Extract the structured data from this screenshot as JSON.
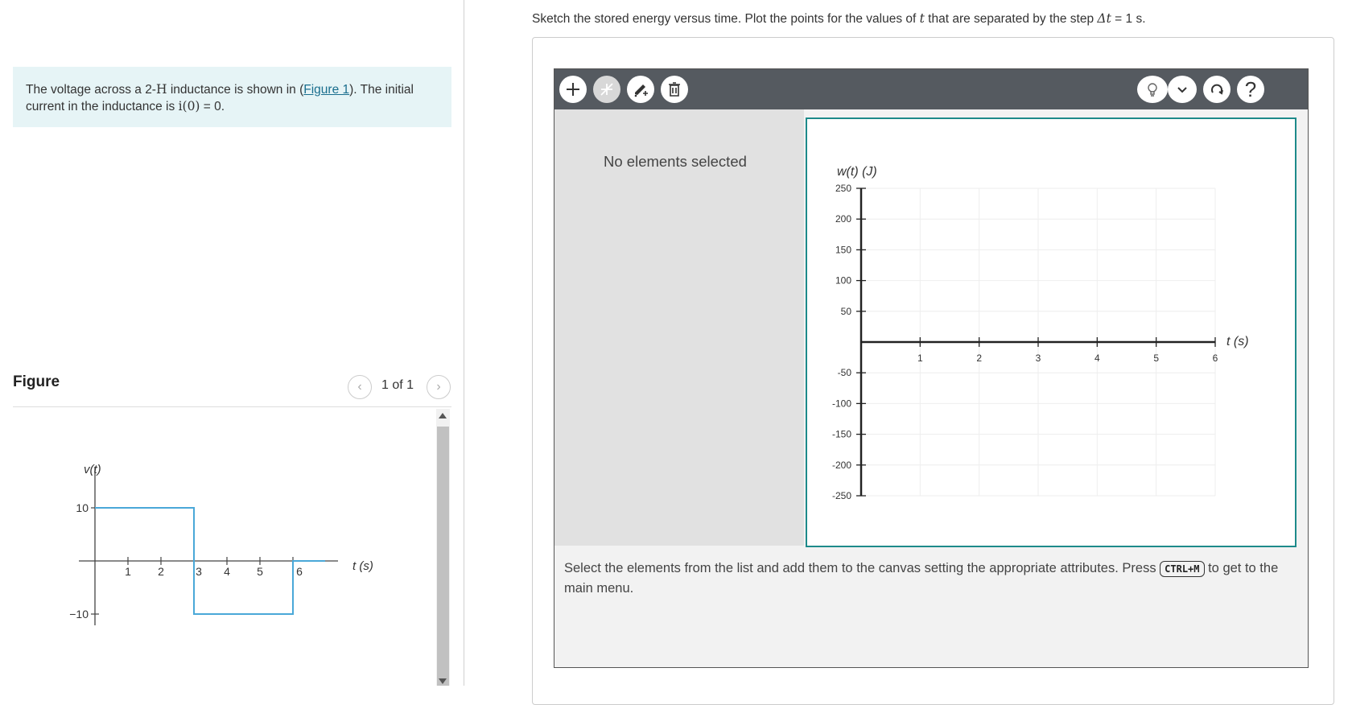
{
  "problem": {
    "text_before": "The voltage across a 2-",
    "unit_H": "H",
    "text_mid": " inductance is shown in (",
    "figure_link": "Figure 1",
    "text_after": "). The initial current in the inductance is ",
    "initial_condition": "i(0)",
    "text_end": " = 0."
  },
  "figure": {
    "title": "Figure",
    "pager": "1 of 1",
    "ylabel": "v(t)",
    "xlabel": "t (s)",
    "y_ticks": [
      "10",
      "−10"
    ],
    "x_ticks": [
      "1",
      "2",
      "3",
      "4",
      "5",
      "6"
    ],
    "waveform": [
      {
        "t0": 0,
        "t1": 3,
        "v": 10
      },
      {
        "t0": 3,
        "t1": 6,
        "v": -10
      }
    ],
    "trace_color": "#4aa8d8"
  },
  "instruction": {
    "text_before": "Sketch the stored energy versus time. Plot the points for the values of ",
    "var_t": "t",
    "text_mid": " that are separated by the step ",
    "delta_t": "Δt",
    "text_after": " = 1 s."
  },
  "toolbar": {
    "left_icons": [
      "add-point-icon",
      "add-line-icon",
      "pen-edit-icon",
      "trash-icon"
    ],
    "right_icons": [
      "hint-lightbulb-icon",
      "chevron-down-icon",
      "reset-icon",
      "help-icon"
    ],
    "help_label": "?"
  },
  "side_panel": {
    "no_elements": "No elements selected"
  },
  "chart_data": {
    "type": "scatter",
    "title": "",
    "ylabel": "w(t) (J)",
    "xlabel": "t (s)",
    "xlim": [
      0,
      6
    ],
    "ylim": [
      -250,
      250
    ],
    "x_ticks": [
      "1",
      "2",
      "3",
      "4",
      "5",
      "6"
    ],
    "y_ticks": [
      "250",
      "200",
      "150",
      "100",
      "50",
      "-50",
      "-100",
      "-150",
      "-200",
      "-250"
    ],
    "grid": true,
    "series": []
  },
  "help": {
    "text_before": "Select the elements from the list and add them to the canvas setting the appropriate attributes. Press ",
    "shortcut": "CTRL+M",
    "text_after": " to get to the main menu."
  },
  "colors": {
    "accent": "#1d8a8a",
    "toolbar": "#555a60",
    "problem_bg": "#e6f4f6"
  }
}
